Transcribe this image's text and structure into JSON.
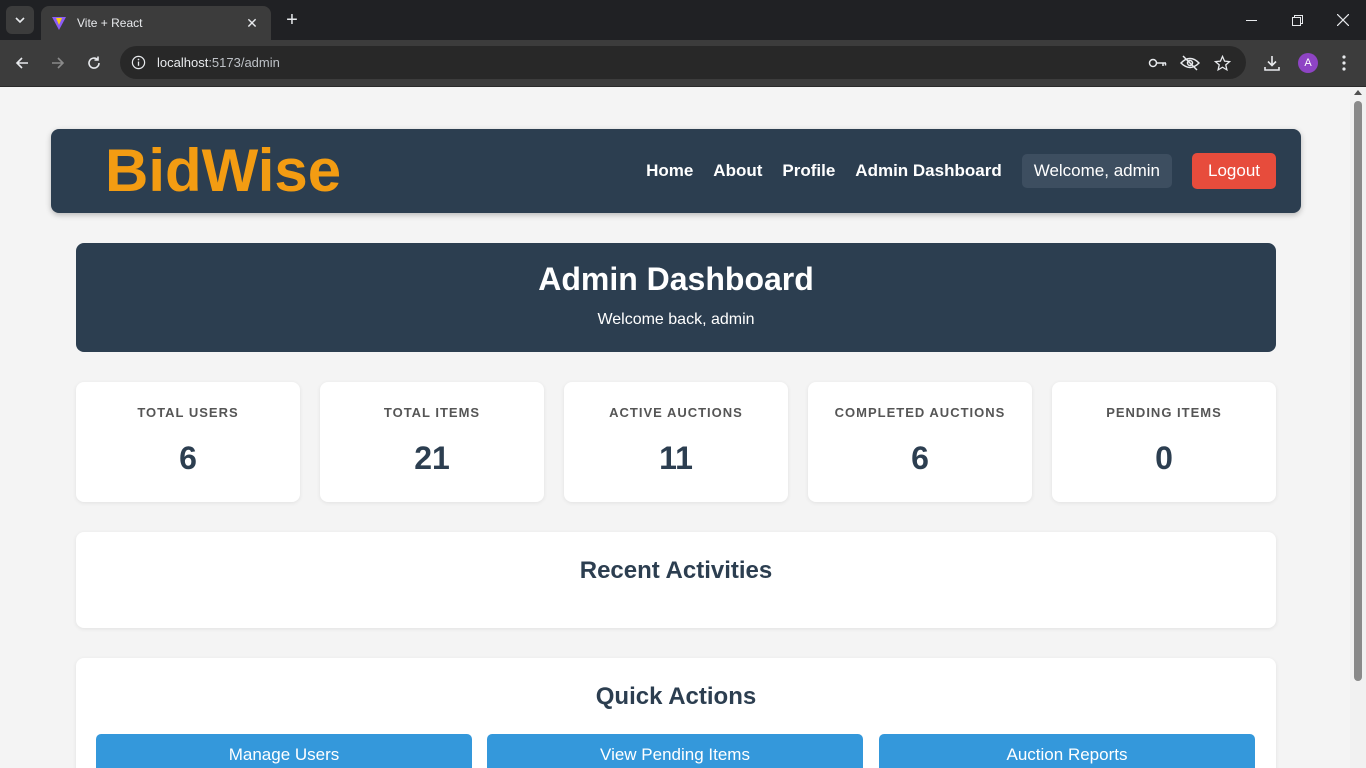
{
  "browser": {
    "tab_title": "Vite + React",
    "url_host": "localhost",
    "url_path": ":5173/admin",
    "profile_initial": "A"
  },
  "navbar": {
    "logo": "BidWise",
    "links": [
      "Home",
      "About",
      "Profile",
      "Admin Dashboard"
    ],
    "welcome": "Welcome, admin",
    "logout": "Logout"
  },
  "hero": {
    "title": "Admin Dashboard",
    "subtitle": "Welcome back, admin"
  },
  "stats": [
    {
      "label": "TOTAL USERS",
      "value": "6"
    },
    {
      "label": "TOTAL ITEMS",
      "value": "21"
    },
    {
      "label": "ACTIVE AUCTIONS",
      "value": "11"
    },
    {
      "label": "COMPLETED AUCTIONS",
      "value": "6"
    },
    {
      "label": "PENDING ITEMS",
      "value": "0"
    }
  ],
  "recent": {
    "title": "Recent Activities"
  },
  "quick_actions": {
    "title": "Quick Actions",
    "buttons": [
      "Manage Users",
      "View Pending Items",
      "Auction Reports"
    ]
  },
  "colors": {
    "navbar_bg": "#2c3e50",
    "logo": "#f39c12",
    "logout": "#e74c3c",
    "action_button": "#3498db",
    "page_bg": "#f4f4f4"
  }
}
